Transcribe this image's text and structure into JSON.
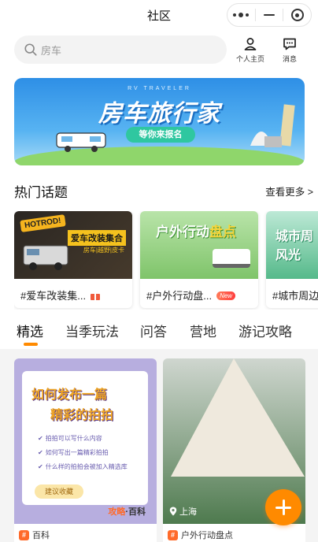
{
  "nav": {
    "title": "社区"
  },
  "search": {
    "placeholder": "房车"
  },
  "header_actions": [
    {
      "label": "个人主页",
      "icon": "user-icon"
    },
    {
      "label": "消息",
      "icon": "message-icon"
    }
  ],
  "banner": {
    "subtitle": "RV TRAVELER",
    "title": "房车旅行家",
    "cta": "等你来报名"
  },
  "hot_topics": {
    "title": "热门话题",
    "more": "查看更多 >",
    "items": [
      {
        "caption": "#爱车改装集...",
        "image_text_1": "HOTROD!",
        "image_text_2": "爱车改装集合",
        "image_text_3": "房车|越野|皮卡",
        "badge_icon": "gift-icon"
      },
      {
        "caption": "#户外行动盘...",
        "image_text_1": "户外行动",
        "image_text_2": "盘点",
        "badge": "New"
      },
      {
        "caption": "#城市周边",
        "image_text_1": "城市周",
        "image_text_2": "风光"
      }
    ]
  },
  "tabs": [
    {
      "label": "精选",
      "active": true
    },
    {
      "label": "当季玩法",
      "active": false
    },
    {
      "label": "问答",
      "active": false
    },
    {
      "label": "营地",
      "active": false
    },
    {
      "label": "游记攻略",
      "active": false
    }
  ],
  "feed": [
    {
      "image": {
        "headline_1": "如何发布一篇",
        "headline_2": "精彩的拍拍",
        "list": [
          "拍拍可以写什么内容",
          "如何写出一篇精彩拍拍",
          "什么样的拍拍会被加入精选库"
        ],
        "button": "建议收藏",
        "brand_a": "攻略",
        "brand_b": "·百科"
      },
      "tag": "百科"
    },
    {
      "image": {
        "location": "上海"
      },
      "tag": "户外行动盘点"
    }
  ],
  "colors": {
    "accent": "#ff8a00",
    "tag": "#ff6a2a"
  }
}
